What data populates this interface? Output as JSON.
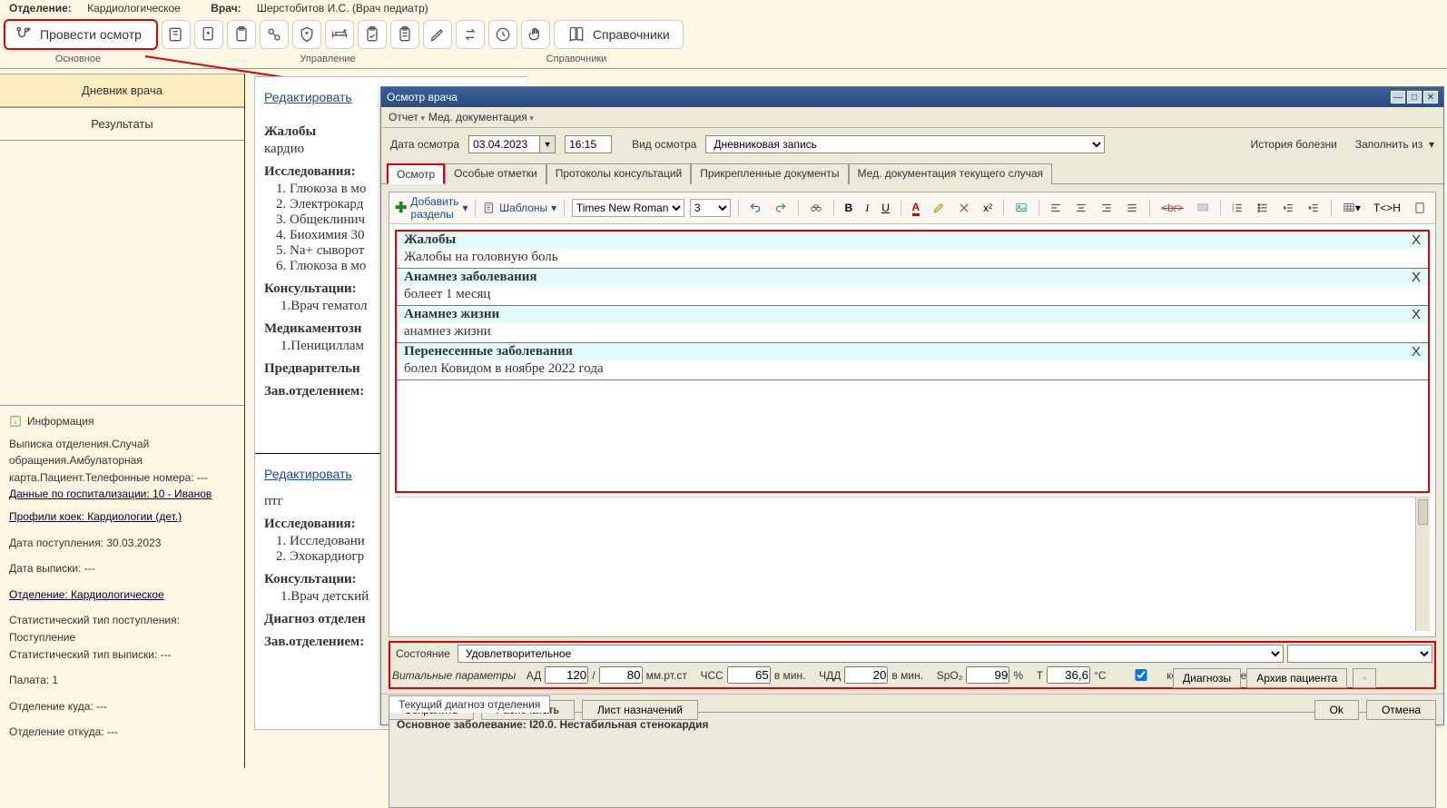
{
  "header": {
    "dept_label": "Отделение:",
    "dept_value": "Кардиологическое",
    "doctor_label": "Врач:",
    "doctor_value": "Шерстобитов И.С. (Врач педиатр)"
  },
  "toolbar": {
    "perform_exam": "Провести осмотр",
    "references": "Справочники",
    "group_main": "Основное",
    "group_manage": "Управление",
    "group_ref": "Справочники"
  },
  "left": {
    "tab_diary": "Дневник врача",
    "tab_results": "Результаты",
    "info_title": "Информация",
    "info_lines": [
      "Выписка отделения.Случай обращения.Амбулаторная карта.Пациент.Телефонные номера: ---",
      "Данные по госпитализации: 10 - Иванов",
      "Профили коек: Кардиологии (дет.)",
      "Дата поступления: 30.03.2023",
      "Дата выписки: ---",
      "Отделение: Кардиологическое",
      "Статистический тип поступления: Поступление",
      "Статистический тип выписки: ---",
      "Палата: 1",
      "Отделение куда: ---",
      "Отделение откуда: ---"
    ]
  },
  "mid": {
    "edit_link": "Редактировать",
    "complaints_h": "Жалобы",
    "complaints_t": "кардио",
    "research_h": "Исследования:",
    "research": [
      "Глюкоза в мо",
      "Электрокард",
      "Общеклинич",
      "Биохимия 30",
      "Na+ сыворот",
      "Глюкоза в мо"
    ],
    "consult_h": "Консультации:",
    "consult": [
      "Врач гематол"
    ],
    "meds_h": "Медикаментозн",
    "meds": [
      "Пенициллам"
    ],
    "prelim_h": "Предварительн",
    "sign_h": "Зав.отделением:",
    "b2_text": "птг",
    "b2_research": [
      "Исследовани",
      "Эхокардиогр"
    ],
    "b2_consult_h": "Консультации:",
    "b2_consult": [
      "Врач детский"
    ],
    "b2_diag_h": "Диагноз отделен",
    "b2_sign_h": "Зав.отделением:"
  },
  "dialog": {
    "title": "Осмотр врача",
    "menu_report": "Отчет",
    "menu_meddoc": "Мед. документация",
    "date_label": "Дата осмотра",
    "date_value": "03.04.2023",
    "time_value": "16:15",
    "type_label": "Вид осмотра",
    "type_value": "Дневниковая запись",
    "history_btn": "История болезни",
    "fill_from": "Заполнить из",
    "tabs": [
      "Осмотр",
      "Особые отметки",
      "Протоколы консультаций",
      "Прикрепленные документы",
      "Мед. документация текущего случая"
    ],
    "add_sections": "Добавить разделы",
    "templates": "Шаблоны",
    "font": "Times New Roman",
    "font_size": "3",
    "sections": [
      {
        "h": "Жалобы",
        "c": "Жалобы на головную боль"
      },
      {
        "h": "Анамнез заболевания",
        "c": "болеет 1 месяц"
      },
      {
        "h": "Анамнез жизни",
        "c": "анамнез жизни"
      },
      {
        "h": "Перенесенные заболевания",
        "c": "болел Ковидом в  ноябре 2022 года"
      }
    ],
    "section_close": "X",
    "state_label": "Состояние",
    "state_value": "Удовлетворительное",
    "vitals_label": "Витальные параметры",
    "ad_label": "АД",
    "ad1": "120",
    "ad_sep": "/",
    "ad2": "80",
    "ad_unit": "мм.рт.ст",
    "hr_label": "ЧСС",
    "hr": "65",
    "hr_unit": "в мин.",
    "br_label": "ЧДД",
    "br": "20",
    "br_unit": "в мин.",
    "spo_label": "SpO₂",
    "spo": "99",
    "spo_unit": "%",
    "t_label": "T",
    "t": "36,6",
    "t_unit": "°C",
    "copy_label": "копировать в темп.лист",
    "btn_diag": "Диагнозы",
    "btn_arch": "Архив пациента",
    "diag_tab": "Текущий диагноз отделения",
    "diag_text": "Основное заболевание: I20.0. Нестабильная стенокардия",
    "btn_save": "Сохранить",
    "btn_print": "Распечатать",
    "btn_presc": "Лист назначений",
    "btn_ok": "Ok",
    "btn_cancel": "Отмена"
  }
}
